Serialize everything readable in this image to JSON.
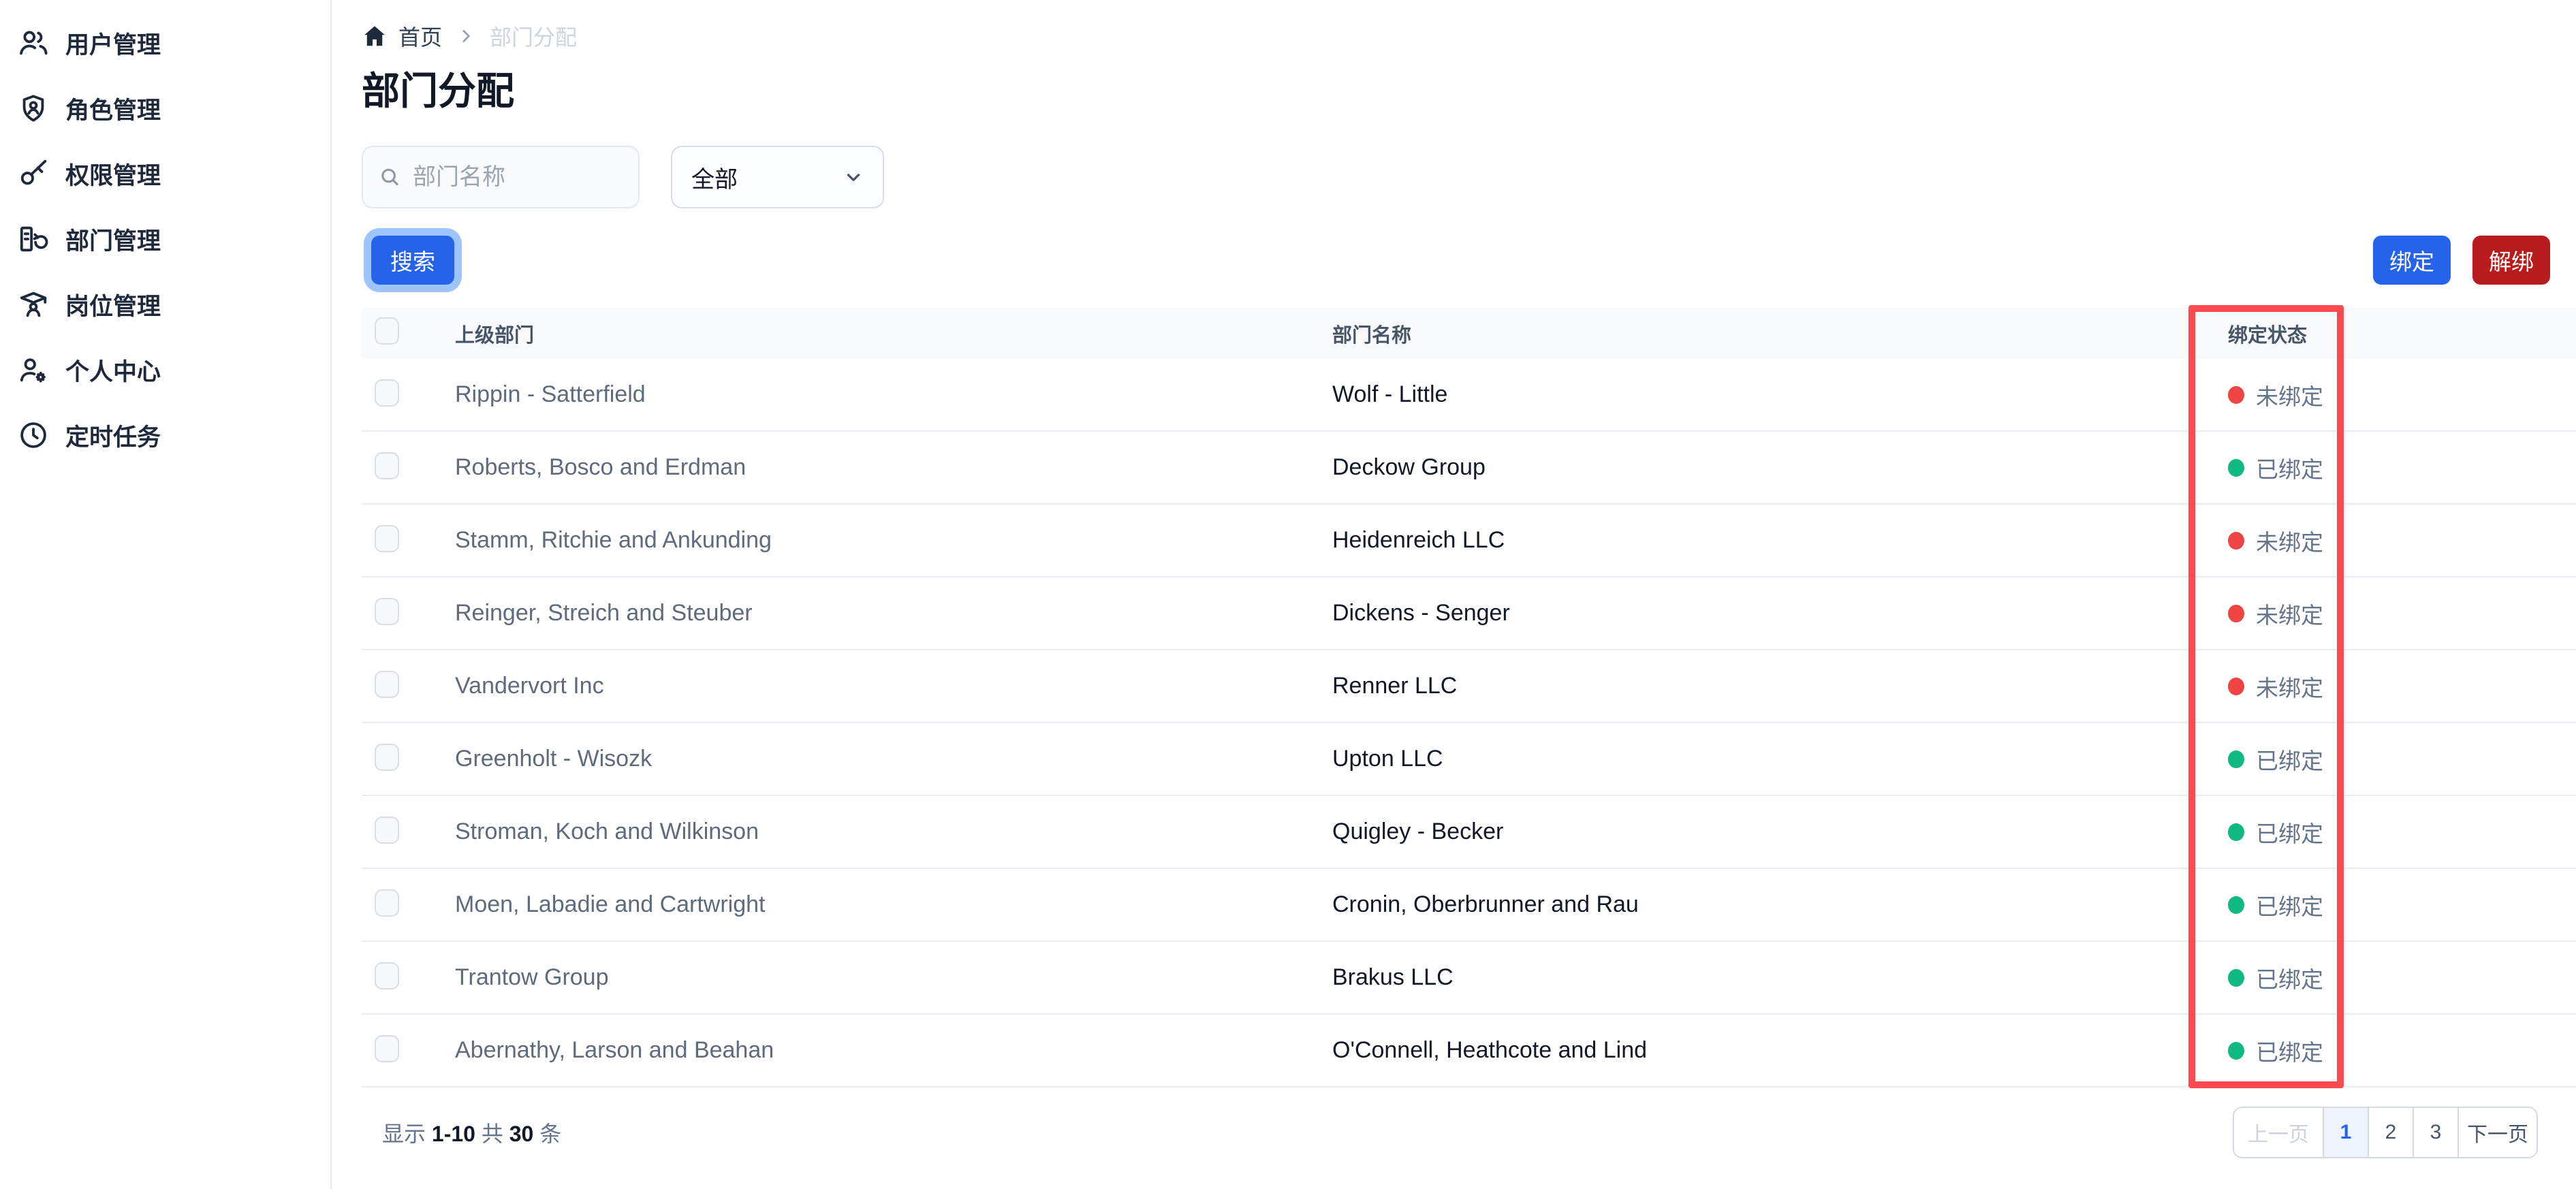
{
  "sidebar": {
    "items": [
      {
        "label": "用户管理",
        "icon": "users-icon"
      },
      {
        "label": "角色管理",
        "icon": "shield-user-icon"
      },
      {
        "label": "权限管理",
        "icon": "key-icon"
      },
      {
        "label": "部门管理",
        "icon": "department-icon"
      },
      {
        "label": "岗位管理",
        "icon": "graduate-icon"
      },
      {
        "label": "个人中心",
        "icon": "user-gear-icon"
      },
      {
        "label": "定时任务",
        "icon": "clock-icon"
      }
    ]
  },
  "breadcrumb": {
    "home": "首页",
    "current": "部门分配"
  },
  "page": {
    "title": "部门分配"
  },
  "filters": {
    "search_placeholder": "部门名称",
    "select_value": "全部",
    "search_button": "搜索"
  },
  "actions": {
    "bind": "绑定",
    "unbind": "解绑"
  },
  "table": {
    "columns": {
      "parent": "上级部门",
      "name": "部门名称",
      "status": "绑定状态"
    },
    "rows": [
      {
        "parent": "Rippin - Satterfield",
        "name": "Wolf - Little",
        "status": "未绑定",
        "bound": false
      },
      {
        "parent": "Roberts, Bosco and Erdman",
        "name": "Deckow Group",
        "status": "已绑定",
        "bound": true
      },
      {
        "parent": "Stamm, Ritchie and Ankunding",
        "name": "Heidenreich LLC",
        "status": "未绑定",
        "bound": false
      },
      {
        "parent": "Reinger, Streich and Steuber",
        "name": "Dickens - Senger",
        "status": "未绑定",
        "bound": false
      },
      {
        "parent": "Vandervort Inc",
        "name": "Renner LLC",
        "status": "未绑定",
        "bound": false
      },
      {
        "parent": "Greenholt - Wisozk",
        "name": "Upton LLC",
        "status": "已绑定",
        "bound": true
      },
      {
        "parent": "Stroman, Koch and Wilkinson",
        "name": "Quigley - Becker",
        "status": "已绑定",
        "bound": true
      },
      {
        "parent": "Moen, Labadie and Cartwright",
        "name": "Cronin, Oberbrunner and Rau",
        "status": "已绑定",
        "bound": true
      },
      {
        "parent": "Trantow Group",
        "name": "Brakus LLC",
        "status": "已绑定",
        "bound": true
      },
      {
        "parent": "Abernathy, Larson and Beahan",
        "name": "O'Connell, Heathcote and Lind",
        "status": "已绑定",
        "bound": true
      }
    ]
  },
  "annotation": {
    "highlighted_column": "绑定状态",
    "highlight_color": "#fb4b4e"
  },
  "footer": {
    "show": "显示",
    "range": "1-10",
    "of": "共",
    "total": "30",
    "unit": "条"
  },
  "pagination": {
    "prev": "上一页",
    "pages": [
      "1",
      "2",
      "3"
    ],
    "active_page": "1",
    "next": "下一页"
  },
  "colors": {
    "accent_blue": "#2563eb",
    "danger_red": "#b91c1c",
    "status_unbound_dot": "#ef4444",
    "status_bound_dot": "#10b981",
    "focus_ring": "#9ec5fb"
  }
}
